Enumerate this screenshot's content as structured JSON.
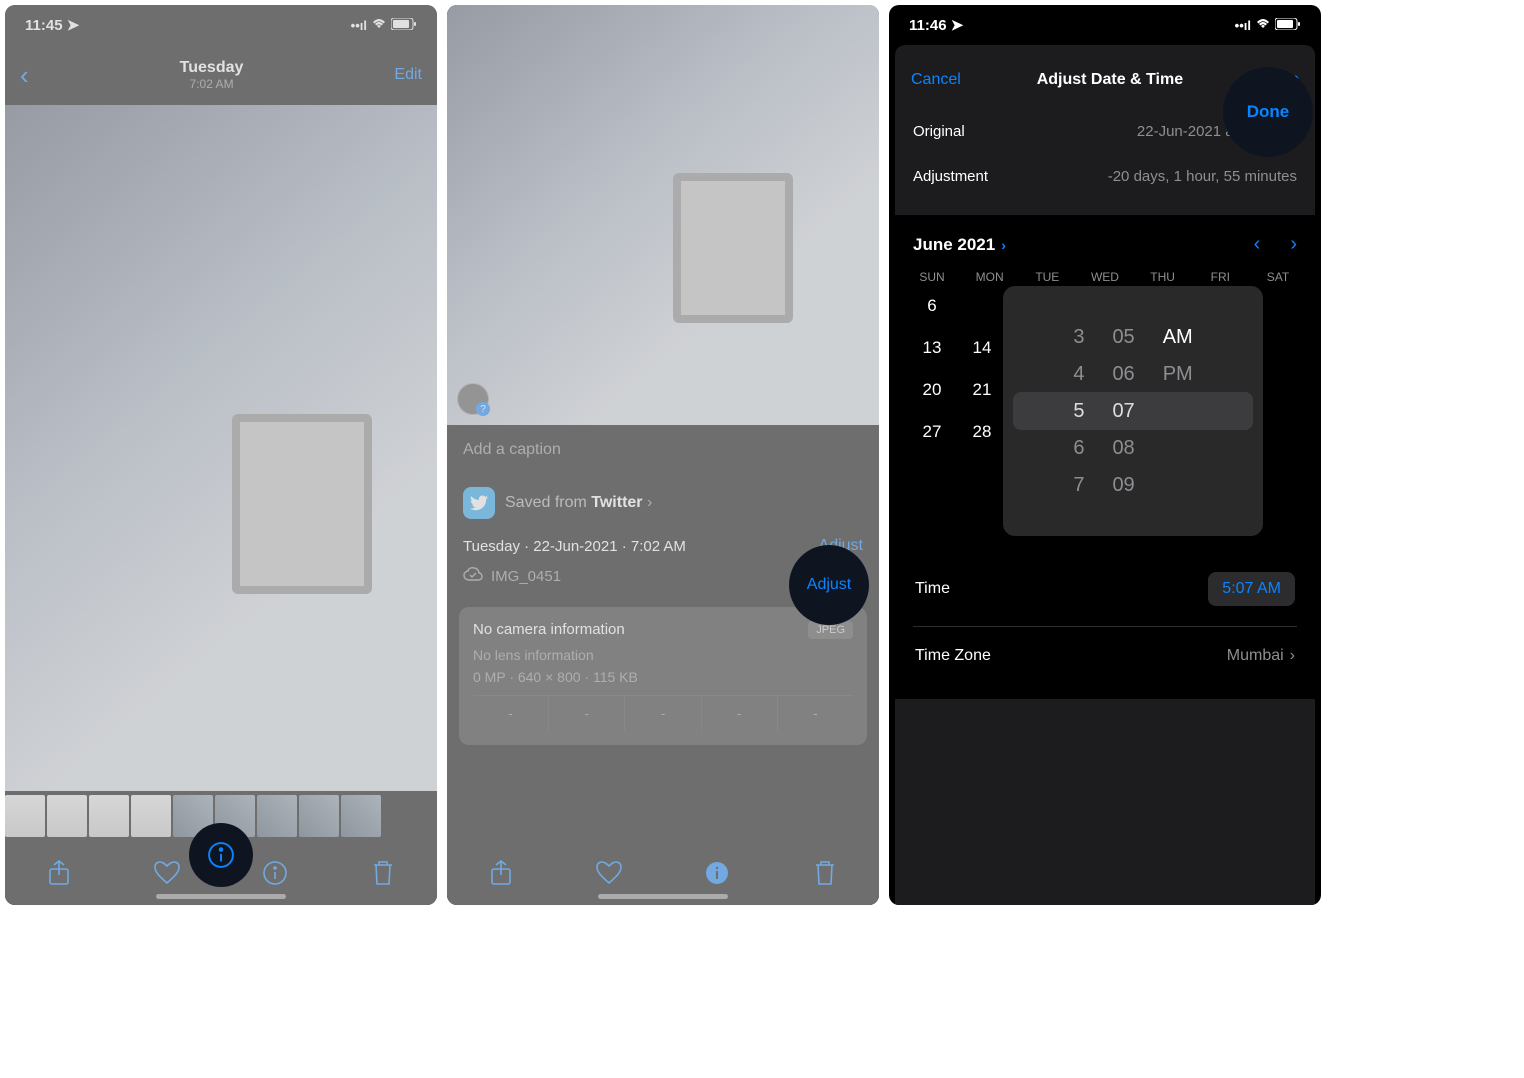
{
  "screen1": {
    "status": {
      "time": "11:45",
      "loc_icon": "➤"
    },
    "nav": {
      "title": "Tuesday",
      "subtitle": "7:02 AM",
      "edit": "Edit"
    }
  },
  "screen2": {
    "caption_placeholder": "Add a caption",
    "source_prefix": "Saved from ",
    "source_name": "Twitter",
    "datetime": "Tuesday · 22-Jun-2021 · 7:02 AM",
    "adjust": "Adjust",
    "filename": "IMG_0451",
    "camera": {
      "title": "No camera information",
      "badge": "JPEG",
      "lens": "No lens information",
      "stats": "0 MP  ·  640 × 800  ·  115 KB",
      "cells": [
        "-",
        "-",
        "-",
        "-",
        "-"
      ]
    }
  },
  "screen3": {
    "status": {
      "time": "11:46"
    },
    "header": {
      "cancel": "Cancel",
      "title": "Adjust Date & Time",
      "done": "Done"
    },
    "original_label": "Original",
    "original_value": "22-Jun-2021 at 7:02 AM",
    "adjustment_label": "Adjustment",
    "adjustment_value": "-20 days, 1 hour, 55 minutes",
    "month": "June 2021",
    "weekdays": [
      "SUN",
      "MON",
      "TUE",
      "WED",
      "THU",
      "FRI",
      "SAT"
    ],
    "visible_dates": [
      [
        "6",
        ""
      ],
      [
        "13",
        "14"
      ],
      [
        "20",
        "21"
      ],
      [
        "27",
        "28"
      ]
    ],
    "picker": {
      "hours": [
        "3",
        "4",
        "5",
        "6",
        "7"
      ],
      "mins": [
        "05",
        "06",
        "07",
        "08",
        "09"
      ],
      "ampm": [
        "AM",
        "PM"
      ],
      "sel_hour_idx": 2,
      "sel_min_idx": 2,
      "sel_ampm_idx": 0
    },
    "time_label": "Time",
    "time_value": "5:07 AM",
    "tz_label": "Time Zone",
    "tz_value": "Mumbai"
  }
}
